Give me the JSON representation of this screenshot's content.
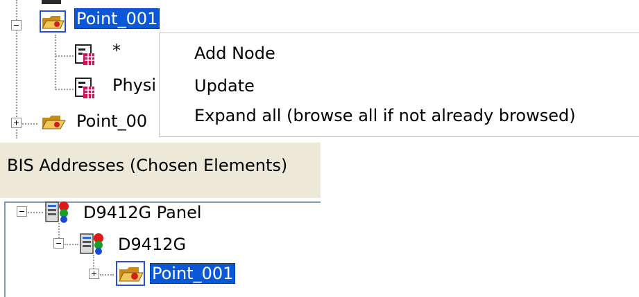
{
  "top_tree": {
    "nodes": [
      {
        "label": "Point_001",
        "selected": true
      },
      {
        "label": "*"
      },
      {
        "label": "Physi"
      },
      {
        "label": "Point_00"
      }
    ]
  },
  "context_menu": {
    "items": [
      "Add Node",
      "Update",
      "Expand all (browse all if not already browsed)"
    ]
  },
  "bis_panel": {
    "title": "BIS Addresses (Chosen Elements)",
    "tree": [
      {
        "label": "D9412G Panel"
      },
      {
        "label": "D9412G"
      },
      {
        "label": "Point_001",
        "selected": true
      }
    ]
  },
  "colors": {
    "selection": "#0a58d6",
    "panel_header_bg": "#ece9d8",
    "folder": "#e8b84a",
    "db_icon": "#c8104a"
  }
}
